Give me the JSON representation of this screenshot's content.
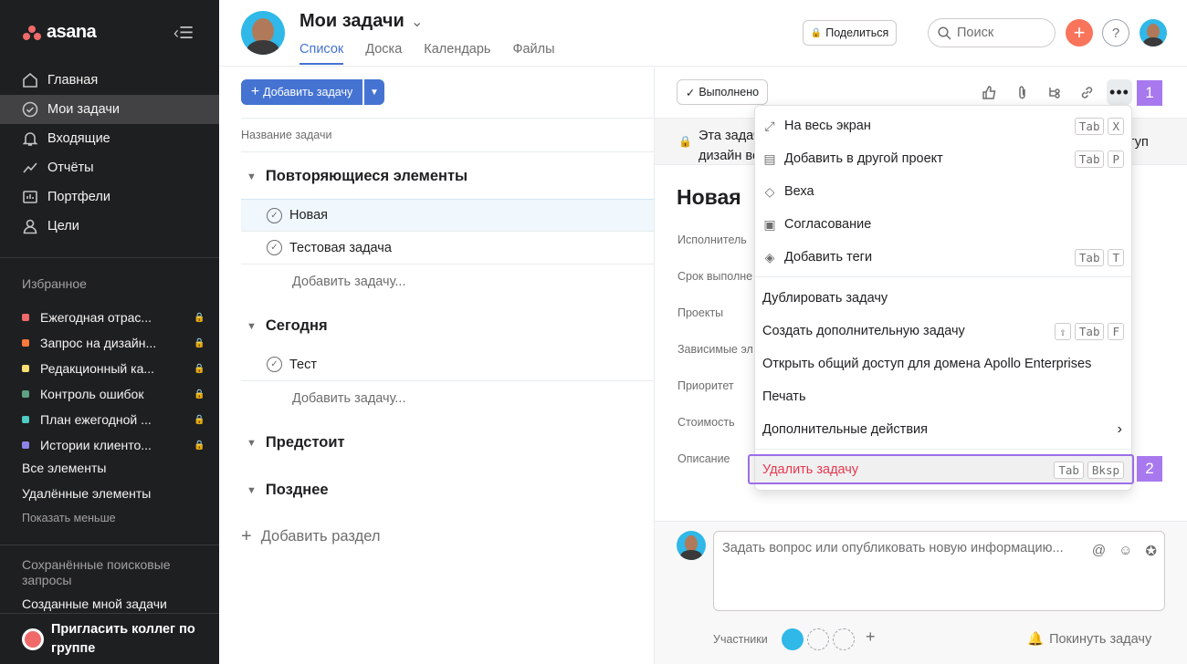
{
  "brand": {
    "logo_text": "asana"
  },
  "sidebar": {
    "nav": [
      {
        "label": "Главная"
      },
      {
        "label": "Мои задачи"
      },
      {
        "label": "Входящие"
      },
      {
        "label": "Отчёты"
      },
      {
        "label": "Портфели"
      },
      {
        "label": "Цели"
      }
    ],
    "favorites_title": "Избранное",
    "favorites": [
      {
        "label": "Ежегодная отрас...",
        "color": "#f06a6a"
      },
      {
        "label": "Запрос на дизайн...",
        "color": "#fd7a3b"
      },
      {
        "label": "Редакционный ка...",
        "color": "#f8df72"
      },
      {
        "label": "Контроль ошибок",
        "color": "#5da283"
      },
      {
        "label": "План ежегодной ...",
        "color": "#4ecbc4"
      },
      {
        "label": "Истории клиенто...",
        "color": "#8d84e8"
      }
    ],
    "all_items": "Все элементы",
    "deleted_items": "Удалённые элементы",
    "show_less": "Показать меньше",
    "saved_title": "Сохранённые поисковые запросы",
    "created_by_me": "Созданные мной задачи",
    "invite": "Пригласить коллег по группе"
  },
  "header": {
    "title": "Мои задачи",
    "tabs": [
      "Список",
      "Доска",
      "Календарь",
      "Файлы"
    ],
    "share": "Поделиться",
    "search_placeholder": "Поиск",
    "help": "?"
  },
  "list": {
    "add_task": "Добавить задачу",
    "column_header": "Название задачи",
    "sections": [
      {
        "title": "Повторяющиеся элементы",
        "tasks": [
          "Новая",
          "Тестовая задача"
        ],
        "add": "Добавить задачу..."
      },
      {
        "title": "Сегодня",
        "tasks": [
          "Тест"
        ],
        "add": "Добавить задачу..."
      },
      {
        "title": "Предстоит"
      },
      {
        "title": "Позднее"
      }
    ],
    "add_section": "Добавить раздел"
  },
  "detail": {
    "done_button": "Выполнено",
    "banner_line1": "Эта задач",
    "banner_line2": "дизайн ве",
    "banner_right": "туп",
    "task_title": "Новая",
    "fields": [
      "Исполнитель",
      "Срок выполне",
      "Проекты",
      "Зависимые эл",
      "Приоритет",
      "Стоимость",
      "Описание"
    ],
    "comment_placeholder": "Задать вопрос или опубликовать новую информацию...",
    "members_label": "Участники",
    "leave": "Покинуть задачу"
  },
  "menu": {
    "items": [
      {
        "label": "На весь экран",
        "icon": "expand-icon",
        "keys": [
          "Tab",
          "X"
        ]
      },
      {
        "label": "Добавить в другой проект",
        "icon": "clipboard-icon",
        "keys": [
          "Tab",
          "P"
        ]
      },
      {
        "label": "Веха",
        "icon": "diamond-icon",
        "keys": []
      },
      {
        "label": "Согласование",
        "icon": "approval-icon",
        "keys": []
      },
      {
        "label": "Добавить теги",
        "icon": "tag-icon",
        "keys": [
          "Tab",
          "T"
        ]
      }
    ],
    "items2": [
      {
        "label": "Дублировать задачу",
        "keys": []
      },
      {
        "label": "Создать дополнительную задачу",
        "keys": [
          "⇧",
          "Tab",
          "F"
        ]
      },
      {
        "label": "Открыть общий доступ для домена Apollo Enterprises",
        "keys": []
      },
      {
        "label": "Печать",
        "keys": []
      },
      {
        "label": "Дополнительные действия",
        "keys": []
      }
    ],
    "delete": {
      "label": "Удалить задачу",
      "keys": [
        "Tab",
        "Bksp"
      ]
    }
  },
  "annotations": {
    "badge1": "1",
    "badge2": "2"
  }
}
